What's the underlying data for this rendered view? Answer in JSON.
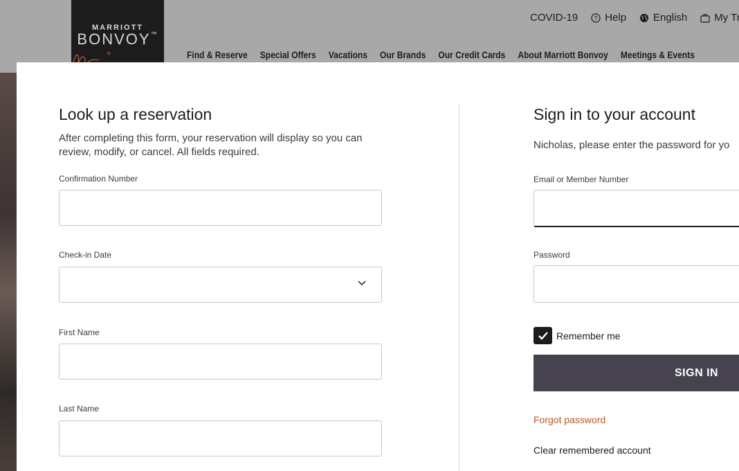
{
  "header": {
    "logo_top": "MARRIOTT",
    "logo_main": "BONVOY",
    "logo_tm": "™",
    "utility": {
      "covid": "COVID-19",
      "help": "Help",
      "language": "English",
      "trips": "My Tr"
    },
    "nav": [
      "Find & Reserve",
      "Special Offers",
      "Vacations",
      "Our Brands",
      "Our Credit Cards",
      "About Marriott Bonvoy",
      "Meetings & Events"
    ]
  },
  "lookup": {
    "title": "Look up a reservation",
    "description": "After completing this form, your reservation will display so you can review, modify, or cancel. All fields required.",
    "confirmation_label": "Confirmation Number",
    "confirmation_value": "",
    "checkin_label": "Check-in Date",
    "checkin_value": "",
    "firstname_label": "First Name",
    "firstname_value": "",
    "lastname_label": "Last Name",
    "lastname_value": ""
  },
  "signin": {
    "title": "Sign in to your account",
    "description": "Nicholas, please enter the password for yo",
    "email_label": "Email or Member Number",
    "email_value": "",
    "password_label": "Password",
    "password_value": "",
    "remember_label": "Remember me",
    "remember_checked": true,
    "button_label": "SIGN IN",
    "forgot_label": "Forgot password",
    "clear_label": "Clear remembered account"
  },
  "colors": {
    "accent_link": "#b5582a",
    "button_bg": "#46434f",
    "header_bg": "#a8a8a8"
  }
}
